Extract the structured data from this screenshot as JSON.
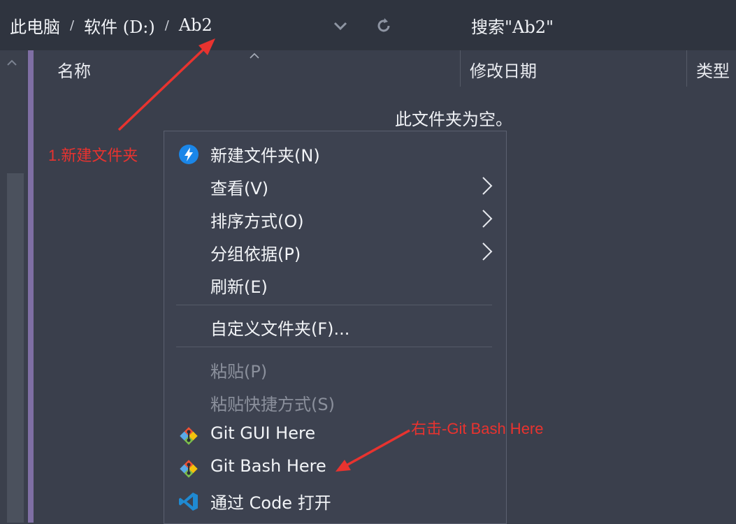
{
  "breadcrumb": {
    "items": [
      "此电脑",
      "软件 (D:)",
      "Ab2"
    ],
    "separator": "/"
  },
  "search": {
    "text": "搜索\"Ab2\""
  },
  "columns": [
    "名称",
    "修改日期",
    "类型"
  ],
  "empty_message": "此文件夹为空。",
  "context_menu": {
    "items": [
      {
        "label": "新建文件夹(N)",
        "icon": "new-folder-bolt-icon"
      },
      {
        "label": "查看(V)",
        "submenu": true
      },
      {
        "label": "排序方式(O)",
        "submenu": true
      },
      {
        "label": "分组依据(P)",
        "submenu": true
      },
      {
        "label": "刷新(E)"
      },
      {
        "label": "自定义文件夹(F)..."
      },
      {
        "label": "粘贴(P)",
        "disabled": true
      },
      {
        "label": "粘贴快捷方式(S)",
        "disabled": true
      },
      {
        "label": "Git GUI Here",
        "icon": "git-icon"
      },
      {
        "label": "Git Bash Here",
        "icon": "git-icon"
      },
      {
        "label": "通过 Code 打开",
        "icon": "vscode-icon"
      }
    ]
  },
  "annotations": {
    "new_folder": "1.新建文件夹",
    "git_bash": "右击-Git Bash Here"
  },
  "colors": {
    "background": "#3a3f4c",
    "menu_background": "#3d4250",
    "accent": "#7f6fa4",
    "annotation": "#e8332f"
  }
}
